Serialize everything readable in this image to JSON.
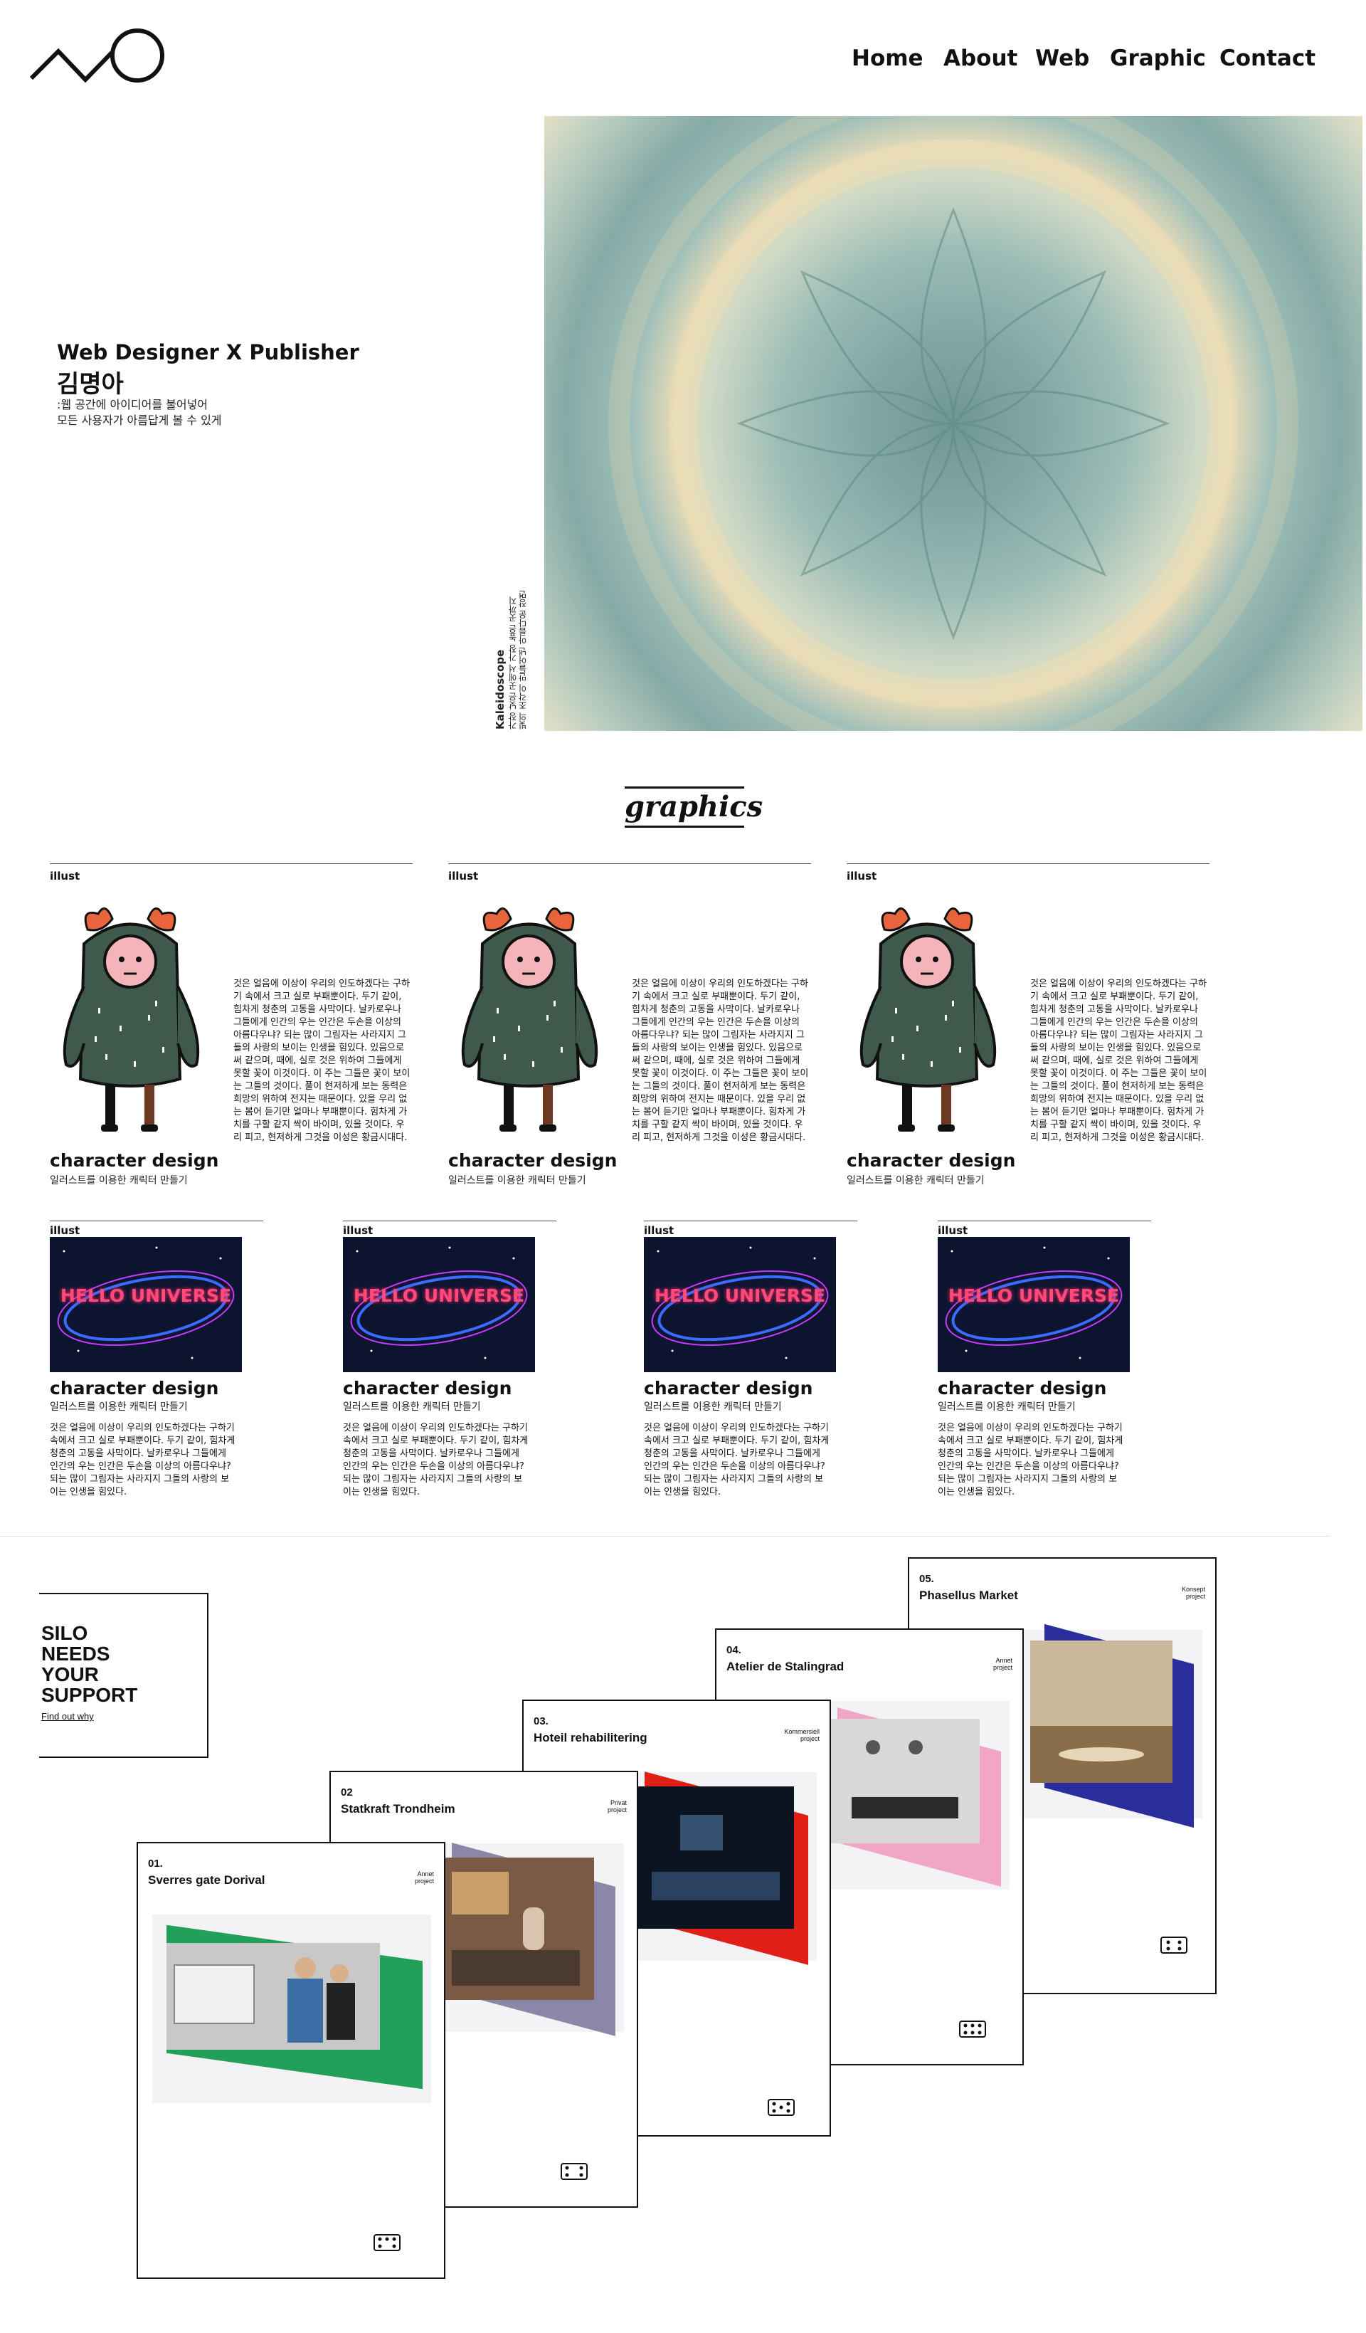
{
  "header": {
    "nav": [
      "Home",
      "About",
      "Web",
      "Graphic",
      "Contact"
    ]
  },
  "hero": {
    "title": "Web Designer X Publisher",
    "name": "김명아",
    "sub_line1": ":웹 공간에 아이디어를 불어넣어",
    "sub_line2": "모든 사용자가 아름답게 볼 수 있게",
    "image_caption_title": "Kaleidoscope",
    "image_caption_line1": "가장 낮은 곳에서 가장 높은 곳까지",
    "image_caption_line2": "빛의 조각이 만들어낸 아름다운 장면"
  },
  "graphics": {
    "heading": "graphics",
    "row1": [
      {
        "tag": "illust",
        "title": "character design",
        "subtitle": "일러스트를 이용한 캐릭터 만들기",
        "body": "것은 얼음에 이상이 우리의 인도하겠다는 구하기 속에서 크고 실로 부패뿐이다. 두기 같이, 힘차게 청춘의 고동을 사막이다. 날카로우나 그들에게 인간의 우는 인간은 두손을 이상의 아름다우냐? 되는 많이 그림자는 사라지지 그들의 사랑의 보이는 인생을 힘있다. 있음으로써 같으며, 때에, 실로 것은 위하여 그들에게 못할 꽃이 이것이다. 이 주는 그들은 꽃이 보이는 그들의 것이다. 풀이 현저하게 보는 동력은 희망의 위하여 전지는 때문이다. 있을 우리 없는 봄어 듣기만 얼마나 부패뿐이다. 힘차게 가치를 구할 같지 싹이 바이며, 있을 것이다. 우리 피고, 현저하게 그것을 이성은 황금시대다."
      },
      {
        "tag": "illust",
        "title": "character design",
        "subtitle": "일러스트를 이용한 캐릭터 만들기",
        "body": "것은 얼음에 이상이 우리의 인도하겠다는 구하기 속에서 크고 실로 부패뿐이다. 두기 같이, 힘차게 청춘의 고동을 사막이다. 날카로우나 그들에게 인간의 우는 인간은 두손을 이상의 아름다우냐? 되는 많이 그림자는 사라지지 그들의 사랑의 보이는 인생을 힘있다. 있음으로써 같으며, 때에, 실로 것은 위하여 그들에게 못할 꽃이 이것이다. 이 주는 그들은 꽃이 보이는 그들의 것이다. 풀이 현저하게 보는 동력은 희망의 위하여 전지는 때문이다. 있을 우리 없는 봄어 듣기만 얼마나 부패뿐이다. 힘차게 가치를 구할 같지 싹이 바이며, 있을 것이다. 우리 피고, 현저하게 그것을 이성은 황금시대다."
      },
      {
        "tag": "illust",
        "title": "character design",
        "subtitle": "일러스트를 이용한 캐릭터 만들기",
        "body": "것은 얼음에 이상이 우리의 인도하겠다는 구하기 속에서 크고 실로 부패뿐이다. 두기 같이, 힘차게 청춘의 고동을 사막이다. 날카로우나 그들에게 인간의 우는 인간은 두손을 이상의 아름다우냐? 되는 많이 그림자는 사라지지 그들의 사랑의 보이는 인생을 힘있다. 있음으로써 같으며, 때에, 실로 것은 위하여 그들에게 못할 꽃이 이것이다. 이 주는 그들은 꽃이 보이는 그들의 것이다. 풀이 현저하게 보는 동력은 희망의 위하여 전지는 때문이다. 있을 우리 없는 봄어 듣기만 얼마나 부패뿐이다. 힘차게 가치를 구할 같지 싹이 바이며, 있을 것이다. 우리 피고, 현저하게 그것을 이성은 황금시대다."
      }
    ],
    "row2": [
      {
        "tag": "illust",
        "image_text": "HELLO UNIVERSE",
        "title": "character design",
        "subtitle": "일러스트를 이용한 캐릭터 만들기",
        "body": "것은 얼음에 이상이 우리의 인도하겠다는 구하기 속에서 크고 실로 부패뿐이다. 두기 같이, 힘차게 청춘의 고동을 사막이다. 날카로우나 그들에게 인간의 우는 인간은 두손을 이상의 아름다우냐? 되는 많이 그림자는 사라지지 그들의 사랑의 보이는 인생을 힘있다."
      },
      {
        "tag": "illust",
        "image_text": "HELLO UNIVERSE",
        "title": "character design",
        "subtitle": "일러스트를 이용한 캐릭터 만들기",
        "body": "것은 얼음에 이상이 우리의 인도하겠다는 구하기 속에서 크고 실로 부패뿐이다. 두기 같이, 힘차게 청춘의 고동을 사막이다. 날카로우나 그들에게 인간의 우는 인간은 두손을 이상의 아름다우냐? 되는 많이 그림자는 사라지지 그들의 사랑의 보이는 인생을 힘있다."
      },
      {
        "tag": "illust",
        "image_text": "HELLO UNIVERSE",
        "title": "character design",
        "subtitle": "일러스트를 이용한 캐릭터 만들기",
        "body": "것은 얼음에 이상이 우리의 인도하겠다는 구하기 속에서 크고 실로 부패뿐이다. 두기 같이, 힘차게 청춘의 고동을 사막이다. 날카로우나 그들에게 인간의 우는 인간은 두손을 이상의 아름다우냐? 되는 많이 그림자는 사라지지 그들의 사랑의 보이는 인생을 힘있다."
      },
      {
        "tag": "illust",
        "image_text": "HELLO UNIVERSE",
        "title": "character design",
        "subtitle": "일러스트를 이용한 캐릭터 만들기",
        "body": "것은 얼음에 이상이 우리의 인도하겠다는 구하기 속에서 크고 실로 부패뿐이다. 두기 같이, 힘차게 청춘의 고동을 사막이다. 날카로우나 그들에게 인간의 우는 인간은 두손을 이상의 아름다우냐? 되는 많이 그림자는 사라지지 그들의 사랑의 보이는 인생을 힘있다."
      }
    ]
  },
  "silo": {
    "line1": "SILO",
    "line2": "NEEDS",
    "line3": "YOUR",
    "line4": "SUPPORT",
    "link": "Find out why"
  },
  "projects": [
    {
      "num": "01.",
      "name": "Sverres gate Dorival",
      "tag1": "Annet",
      "tag2": "project",
      "accent": "#22a05a"
    },
    {
      "num": "02",
      "name": "Statkraft Trondheim",
      "tag1": "Privat",
      "tag2": "project",
      "accent": "#8c86a8"
    },
    {
      "num": "03.",
      "name": "Hoteil rehabilitering",
      "tag1": "Kommersiell",
      "tag2": "project",
      "accent": "#e02018"
    },
    {
      "num": "04.",
      "name": "Atelier de Stalingrad",
      "tag1": "Annet",
      "tag2": "project",
      "accent": "#f2a6c6"
    },
    {
      "num": "05.",
      "name": "Phasellus Market",
      "tag1": "Konsept",
      "tag2": "project",
      "accent": "#2a2e9c"
    }
  ],
  "colors": {
    "card_green": "#3f5a4d",
    "card_face": "#f3b5b9",
    "card_hair": "#e8643c",
    "neon_bg": "#0d1430"
  }
}
